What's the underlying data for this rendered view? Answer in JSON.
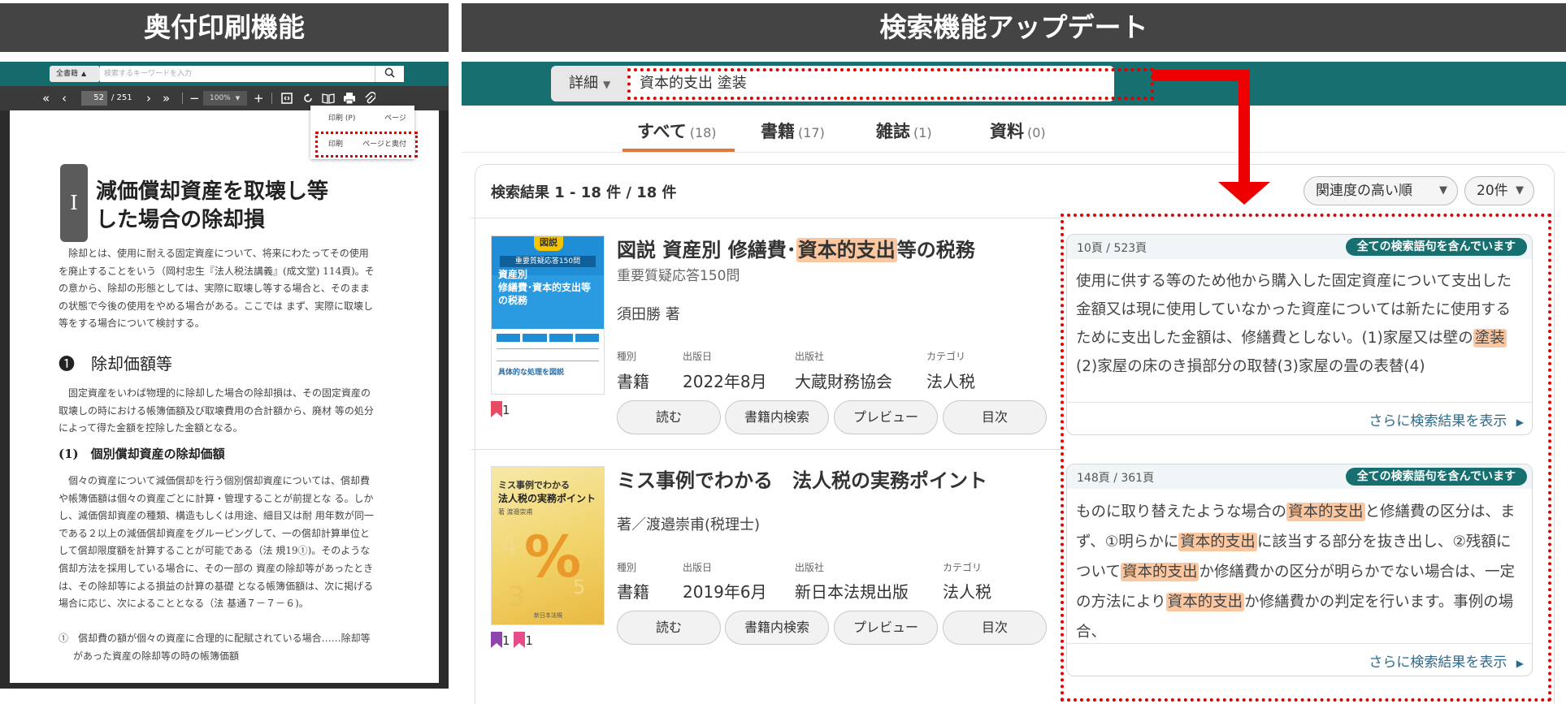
{
  "banners": {
    "left": "奥付印刷機能",
    "right": "検索機能アップデート"
  },
  "viewer": {
    "scope": "全書籍",
    "search_placeholder": "検索するキーワードを入力",
    "first": "«",
    "prev": "‹",
    "page": "52",
    "total": "/ 251",
    "next": "›",
    "last": "»",
    "zoom_out": "−",
    "zoom": "100%",
    "zoom_in": "+",
    "menu": [
      {
        "label": "印刷",
        "key": "(P)",
        "right": "ページ"
      },
      {
        "label": "印刷",
        "key": "",
        "right": "ページと奥付"
      }
    ],
    "doc": {
      "badge": "I",
      "title_line1": "減価償却資産を取壊し等",
      "title_line2": "した場合の除却損",
      "p1": "除却とは、使用に耐える固定資産について、将来にわたってその使用を廃止することをいう（岡村忠生『法人税法講義』(成文堂) 114頁)。その意から、除却の形態としては、実際に取壊し等する場合と、そのままの状態で今後の使用をやめる場合がある。ここでは まず、実際に取壊し等をする場合について検討する。",
      "h1": "❶　除却価額等",
      "p2": "固定資産をいわば物理的に除却した場合の除却損は、その固定資産の取壊しの時における帳簿価額及び取壊費用の合計額から、廃材 等の処分によって得た金額を控除した金額となる。",
      "h2": "(1)　個別償却資産の除却価額",
      "p3": "個々の資産について減価償却を行う個別償却資産については、償却費や帳簿価額は個々の資産ごとに計算・管理することが前提とな る。しかし、減価償却資産の種類、構造もしくは用途、細目又は耐 用年数が同一である２以上の減価償却資産をグルーピングして、一の償却計算単位として償却限度額を計算することが可能である（法 規19①)。そのような償却方法を採用している場合に、その一部の 資産の除却等があったときは、その除却等による損益の計算の基礎 となる帳簿価額は、次に掲げる場合に応じ、次によることとなる（法 基通７－７－６)。",
      "p4": "①　償却費の額が個々の資産に合理的に配賦されている場合……除却等があった資産の除却等の時の帳簿価額"
    }
  },
  "search": {
    "detail_label": "詳細",
    "query": "資本的支出 塗装",
    "tabs": [
      {
        "label": "すべて",
        "count": "(18)"
      },
      {
        "label": "書籍",
        "count": "(17)"
      },
      {
        "label": "雑誌",
        "count": "(1)"
      },
      {
        "label": "資料",
        "count": "(0)"
      }
    ],
    "result_count": "検索結果 1 - 18 件 / 18 件",
    "sort": "関連度の高い順",
    "per_page": "20件",
    "meta_labels": {
      "type": "種別",
      "date": "出版日",
      "publisher": "出版社",
      "category": "カテゴリ"
    },
    "buttons": {
      "read": "読む",
      "inbook": "書籍内検索",
      "preview": "プレビュー",
      "toc": "目次"
    },
    "snippet_badge": "全ての検索語句を含んでいます",
    "more": "さらに検索結果を表示",
    "results": [
      {
        "title_pre": "図説 資産別 修繕費･",
        "title_hl": "資本的支出",
        "title_post": "等の税務",
        "subtitle": "重要質疑応答150問",
        "author": "須田勝 著",
        "type": "書籍",
        "date": "2022年8月",
        "publisher": "大蔵財務協会",
        "category": "法人税",
        "bookmark_count": "1",
        "cover": {
          "tag": "図説",
          "band": "重要質疑応答150問",
          "line1": "資産別",
          "line2": "修繕費･資本的支出等",
          "line3": "の税務",
          "bottom": "具体的な処理を図説"
        },
        "snippet_page": "10頁",
        "snippet_total": "/ 523頁",
        "snippet_parts": [
          "使用に供する等のため他から購入した固定資産について支出した金額又は現に使用していなかった資産については新たに使用するために支出した金額は、修繕費としない。(1)家屋又は壁の",
          "塗装",
          "(2)家屋の床のき損部分の取替(3)家屋の畳の表替(4)"
        ]
      },
      {
        "title": "ミス事例でわかる　法人税の実務ポイント",
        "author": "著／渡邉崇甫(税理士)",
        "type": "書籍",
        "date": "2019年6月",
        "publisher": "新日本法規出版",
        "category": "法人税",
        "bookmark_count_a": "1",
        "bookmark_count_b": "1",
        "cover": {
          "line1": "ミス事例でわかる",
          "line2": "法人税の実務ポイント",
          "author": "著 渡邉崇甫",
          "publisher": "新日本法規"
        },
        "snippet_page": "148頁",
        "snippet_total": "/ 361頁",
        "snippet_parts": [
          "ものに取り替えたような場合の",
          "資本的支出",
          "と修繕費の区分は、まず、①明らかに",
          "資本的支出",
          "に該当する部分を抜き出し、②残額について",
          "資本的支出",
          "か修繕費かの区分が明らかでない場合は、一定の方法により",
          "資本的支出",
          "か修繕費かの判定を行います。事例の場合、"
        ]
      }
    ]
  }
}
